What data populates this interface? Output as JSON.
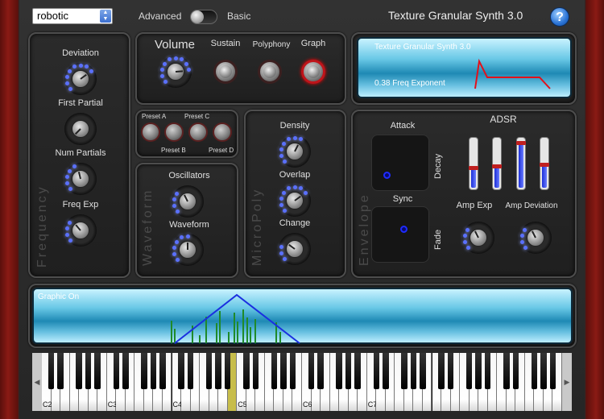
{
  "top": {
    "preset_value": "robotic",
    "mode_left": "Advanced",
    "mode_right": "Basic",
    "title": "Texture Granular Synth 3.0",
    "help_glyph": "?"
  },
  "frequency": {
    "vertical_label": "Frequency",
    "deviation": "Deviation",
    "first_partial": "First Partial",
    "num_partials": "Num Partials",
    "freq_exp": "Freq Exp"
  },
  "volume_row": {
    "volume": "Volume",
    "sustain": "Sustain",
    "polyphony": "Polyphony",
    "graph": "Graph"
  },
  "graph_screen": {
    "title": "Texture Granular Synth 3.0",
    "readout": "0.38 Freq Exponent",
    "line_color": "#e3101a"
  },
  "presets": {
    "a": "Preset A",
    "b": "Preset B",
    "c": "Preset C",
    "d": "Preset D"
  },
  "waveform": {
    "vertical_label": "Waveform",
    "oscillators": "Oscillators",
    "waveform": "Waveform"
  },
  "micropoly": {
    "vertical_label": "MicroPoly",
    "density": "Density",
    "overlap": "Overlap",
    "change": "Change"
  },
  "envelope": {
    "vertical_label": "Envelope",
    "attack": "Attack",
    "decay": "Decay",
    "sync": "Sync",
    "fade": "Fade",
    "adsr": "ADSR",
    "amp_exp": "Amp Exp",
    "amp_deviation": "Amp Deviation",
    "slider_levels": [
      0.42,
      0.45,
      0.92,
      0.48
    ]
  },
  "graphic": {
    "label": "Graphic On",
    "triangle_color": "#1a2fe0",
    "bar_color": "#1f8a2a"
  },
  "keyboard": {
    "octaves": [
      "C2",
      "C3",
      "C4",
      "C5",
      "C6",
      "C7"
    ],
    "left_arrow": "◀",
    "right_arrow": "▶"
  },
  "colors": {
    "knob_led": "#5a70ff",
    "frame": "#8a1a14"
  }
}
